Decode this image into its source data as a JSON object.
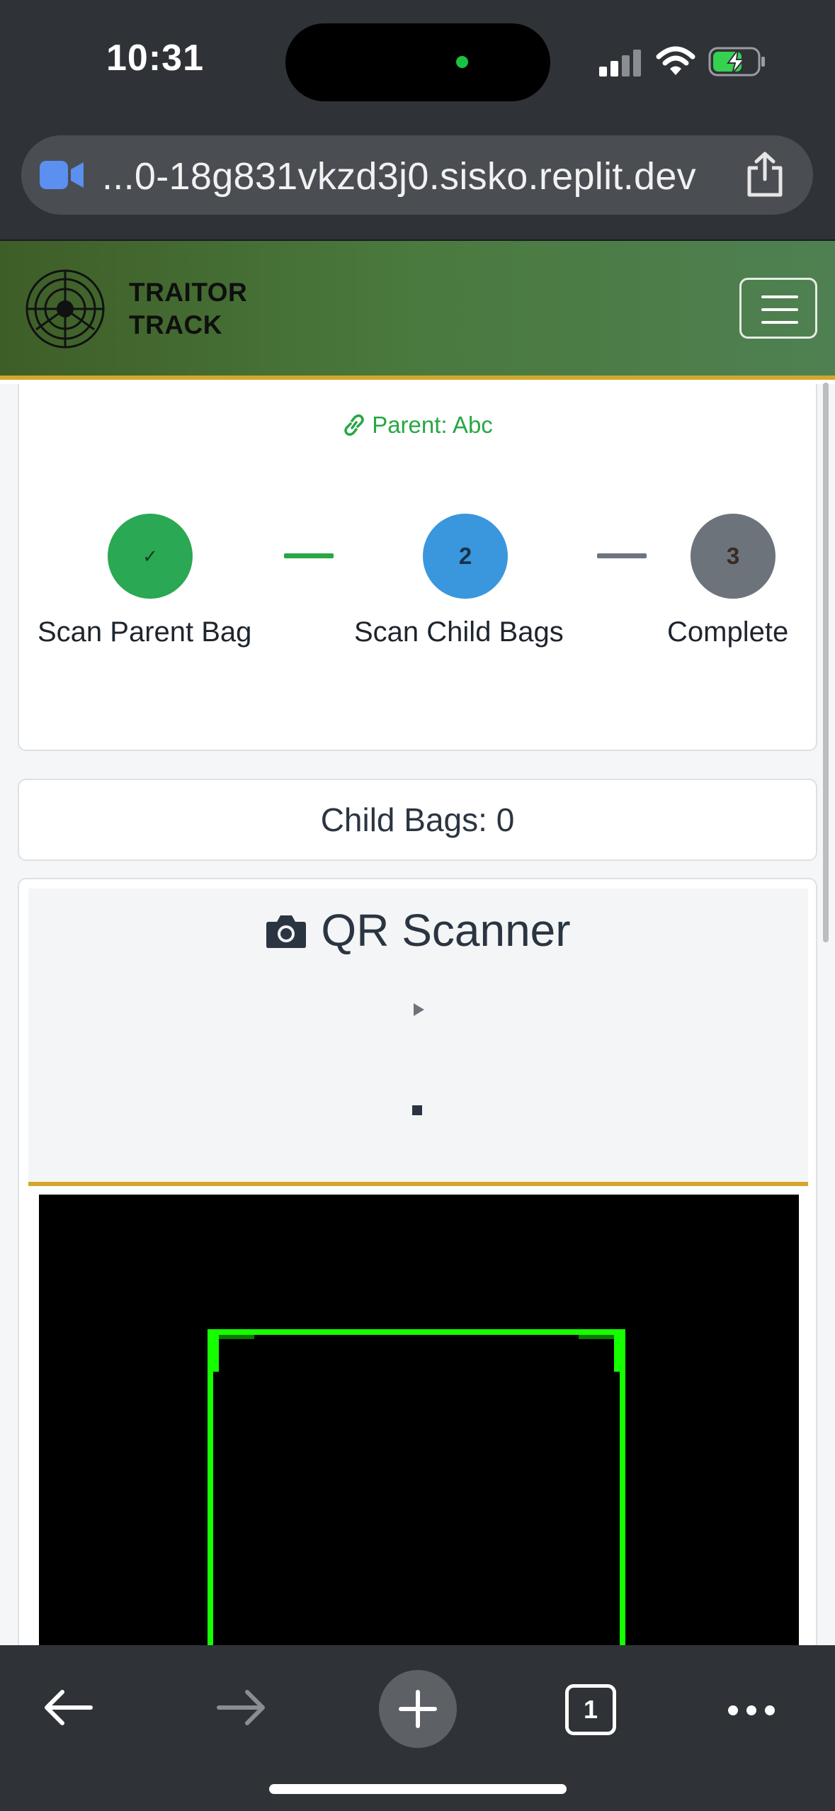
{
  "status_bar": {
    "time": "10:31"
  },
  "browser": {
    "url": "...0-18g831vkzd3j0.sisko.replit.dev",
    "tab_count": "1"
  },
  "navbar": {
    "brand_line1": "TRAITOR",
    "brand_line2": "TRACK"
  },
  "progress": {
    "parent_label": "Parent: Abc",
    "steps": [
      {
        "number": "✓",
        "label": "Scan Parent Bag",
        "color": "#2aa854",
        "state": "done"
      },
      {
        "number": "2",
        "label": "Scan Child Bags",
        "color": "#3a96dd",
        "state": "active"
      },
      {
        "number": "3",
        "label": "Complete",
        "color": "#6c737b",
        "state": "pending"
      }
    ],
    "connector_done_color": "#28a745",
    "connector_pending_color": "#6c757d"
  },
  "child_bags": {
    "label": "Child Bags: 0"
  },
  "scanner": {
    "title": "QR Scanner",
    "frame_color": "#15ff00",
    "accent_color": "#d4a72c"
  },
  "icons": {
    "link": "link-icon",
    "camera": "camera-icon",
    "play": "play-icon",
    "stop": "stop-icon",
    "menu": "hamburger-icon",
    "share": "share-icon",
    "video": "video-camera-icon"
  }
}
